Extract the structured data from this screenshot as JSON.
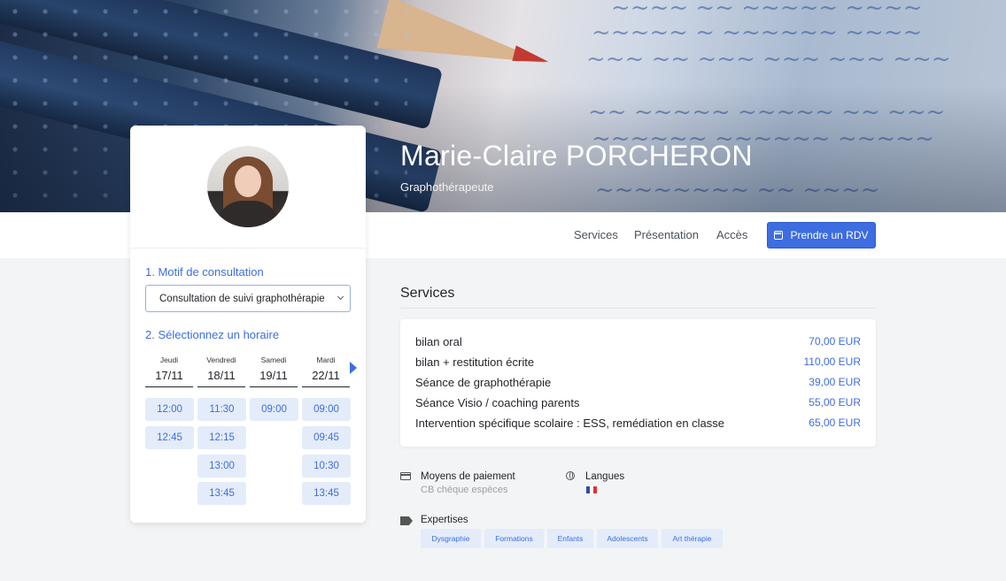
{
  "profile": {
    "name": "Marie-Claire PORCHERON",
    "role": "Graphothérapeute"
  },
  "nav": {
    "links": [
      "Services",
      "Présentation",
      "Accès"
    ],
    "cta_label": "Prendre un RDV",
    "cta_icon": "calendar-icon"
  },
  "booking": {
    "step1_label": "1. Motif de consultation",
    "motif_selected": "Consultation de suivi graphothérapie",
    "step2_label": "2. Sélectionnez un horaire",
    "days": [
      {
        "name": "Jeudi",
        "date": "17/11",
        "slots": [
          "12:00",
          "12:45"
        ]
      },
      {
        "name": "Vendredi",
        "date": "18/11",
        "slots": [
          "11:30",
          "12:15",
          "13:00",
          "13:45"
        ]
      },
      {
        "name": "Samedi",
        "date": "19/11",
        "slots": [
          "09:00"
        ]
      },
      {
        "name": "Mardi",
        "date": "22/11",
        "slots": [
          "09:00",
          "09:45",
          "10:30",
          "13:45"
        ]
      }
    ]
  },
  "services": {
    "title": "Services",
    "items": [
      {
        "name": "bilan oral",
        "price": "70,00 EUR"
      },
      {
        "name": "bilan + restitution écrite",
        "price": "110,00 EUR"
      },
      {
        "name": "Séance de graphothérapie",
        "price": "39,00 EUR"
      },
      {
        "name": "Séance Visio / coaching parents",
        "price": "55,00 EUR"
      },
      {
        "name": "Intervention spécifique scolaire : ESS, remédiation en classe",
        "price": "65,00 EUR"
      }
    ]
  },
  "info": {
    "payment_label": "Moyens de paiement",
    "payment_value": "CB chèque espèces",
    "languages_label": "Langues",
    "language_flag": "french-flag",
    "expertise_label": "Expertises",
    "tags": [
      "Dysgraphie",
      "Formations",
      "Enfants",
      "Adolescents",
      "Art thérapie"
    ]
  },
  "colors": {
    "accent": "#3d6de0",
    "slot_bg": "#e4ecfa"
  }
}
